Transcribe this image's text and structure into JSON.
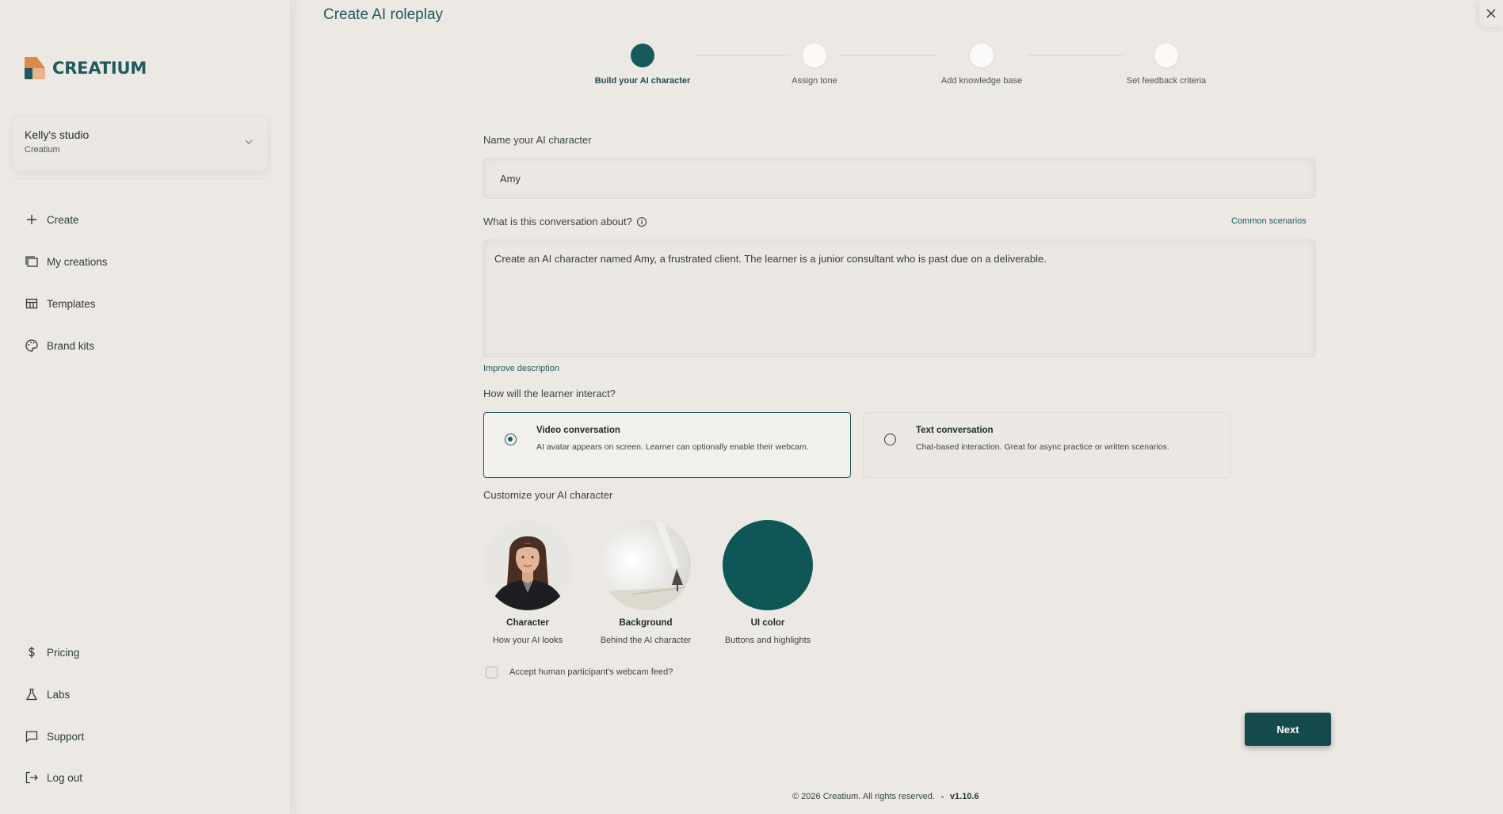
{
  "app": {
    "brand": "CREATIUM",
    "colors": {
      "accent": "#1f5a5c",
      "background": "#ece9e4",
      "ui_color_swatch": "#0f5657"
    }
  },
  "sidebar": {
    "studio": {
      "name": "Kelly's studio",
      "org": "Creatium"
    },
    "items": [
      {
        "label": "Create",
        "icon": "plus-icon"
      },
      {
        "label": "My creations",
        "icon": "folders-icon"
      },
      {
        "label": "Templates",
        "icon": "template-grid-icon"
      },
      {
        "label": "Brand kits",
        "icon": "palette-icon"
      }
    ],
    "bottom_items": [
      {
        "label": "Pricing",
        "icon": "dollar-icon"
      },
      {
        "label": "Labs",
        "icon": "flask-icon"
      },
      {
        "label": "Support",
        "icon": "chat-icon"
      },
      {
        "label": "Log out",
        "icon": "logout-icon"
      }
    ]
  },
  "header": {
    "title": "Create AI roleplay"
  },
  "stepper": {
    "steps": [
      {
        "label": "Build your AI character",
        "active": true
      },
      {
        "label": "Assign tone",
        "active": false
      },
      {
        "label": "Add knowledge base",
        "active": false
      },
      {
        "label": "Set feedback criteria",
        "active": false
      }
    ]
  },
  "form": {
    "name_label": "Name your AI character",
    "name_value": "Amy",
    "conversation_label": "What is this conversation about?",
    "common_scenarios": "Common scenarios",
    "description_value": "Create an AI character named Amy, a frustrated client. The learner is a junior consultant who is past due on a deliverable.",
    "improve_description": "Improve description",
    "interact_label": "How will the learner interact?",
    "options": [
      {
        "title": "Video conversation",
        "desc": "AI avatar appears on screen. Learner can optionally enable their webcam.",
        "selected": true
      },
      {
        "title": "Text conversation",
        "desc": "Chat-based interaction. Great for async practice or written scenarios.",
        "selected": false
      }
    ],
    "customize_label": "Customize your AI character",
    "customize": [
      {
        "title": "Character",
        "sub": "How your AI looks"
      },
      {
        "title": "Background",
        "sub": "Behind the AI character"
      },
      {
        "title": "UI color",
        "sub": "Buttons and highlights"
      }
    ],
    "webcam_checkbox": "Accept human participant's webcam feed?",
    "webcam_checked": false,
    "next_label": "Next"
  },
  "footer": {
    "copyright": "© 2026 Creatium. All rights reserved.",
    "version": "v1.10.6"
  }
}
